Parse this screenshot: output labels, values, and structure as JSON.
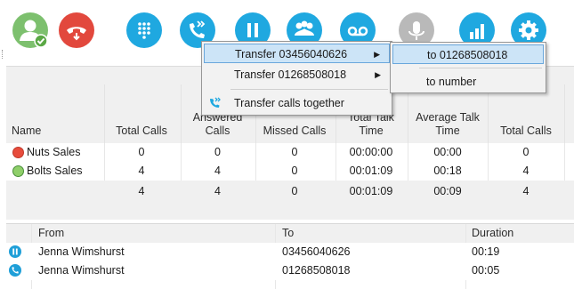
{
  "toolbar": {
    "buttons": [
      {
        "name": "agent-status-icon",
        "color": "#7dc06e"
      },
      {
        "name": "hangup-icon",
        "color": "#e2483d"
      },
      {
        "name": "dialpad-icon",
        "color": "#1fa8e0"
      },
      {
        "name": "transfer-icon",
        "color": "#1fa8e0"
      },
      {
        "name": "hold-icon",
        "color": "#1fa8e0"
      },
      {
        "name": "conference-icon",
        "color": "#1fa8e0"
      },
      {
        "name": "voicemail-icon",
        "color": "#1fa8e0"
      },
      {
        "name": "microphone-icon",
        "color": "#b9b9b9"
      },
      {
        "name": "stats-icon",
        "color": "#1fa8e0"
      },
      {
        "name": "settings-icon",
        "color": "#1fa8e0"
      }
    ]
  },
  "queues": {
    "headers": {
      "name": "Name",
      "total_calls": "Total Calls",
      "answered_calls": "Answered Calls",
      "missed_calls": "Missed Calls",
      "total_talk_time": "Total Talk Time",
      "average_talk_time": "Average Talk Time",
      "total_calls_2": "Total Calls"
    },
    "rows": [
      {
        "status": "red",
        "name": "Nuts Sales",
        "total_calls": "0",
        "answered_calls": "0",
        "missed_calls": "0",
        "total_talk_time": "00:00:00",
        "average_talk_time": "00:00",
        "total_calls_2": "0"
      },
      {
        "status": "green",
        "name": "Bolts Sales",
        "total_calls": "4",
        "answered_calls": "4",
        "missed_calls": "0",
        "total_talk_time": "00:01:09",
        "average_talk_time": "00:18",
        "total_calls_2": "4"
      }
    ],
    "totals": {
      "total_calls": "4",
      "answered_calls": "4",
      "missed_calls": "0",
      "total_talk_time": "00:01:09",
      "average_talk_time": "00:09",
      "total_calls_2": "4"
    }
  },
  "calls": {
    "headers": {
      "from": "From",
      "to": "To",
      "duration": "Duration"
    },
    "rows": [
      {
        "state_icon": "hold-icon",
        "from": "Jenna Wimshurst",
        "to": "03456040626",
        "duration": "00:19"
      },
      {
        "state_icon": "phone-icon",
        "from": "Jenna Wimshurst",
        "to": "01268508018",
        "duration": "00:05"
      }
    ]
  },
  "transfer_menu": {
    "items": [
      {
        "label": "Transfer 03456040626",
        "has_submenu": true,
        "highlighted": true
      },
      {
        "label": "Transfer 01268508018",
        "has_submenu": true,
        "highlighted": false
      },
      {
        "label": "Transfer calls together",
        "has_submenu": false,
        "highlighted": false,
        "icon": "transfer-icon"
      }
    ]
  },
  "transfer_submenu": {
    "items": [
      {
        "label": "to 01268508018",
        "highlighted": true
      },
      {
        "label": "to number",
        "highlighted": false
      }
    ]
  }
}
